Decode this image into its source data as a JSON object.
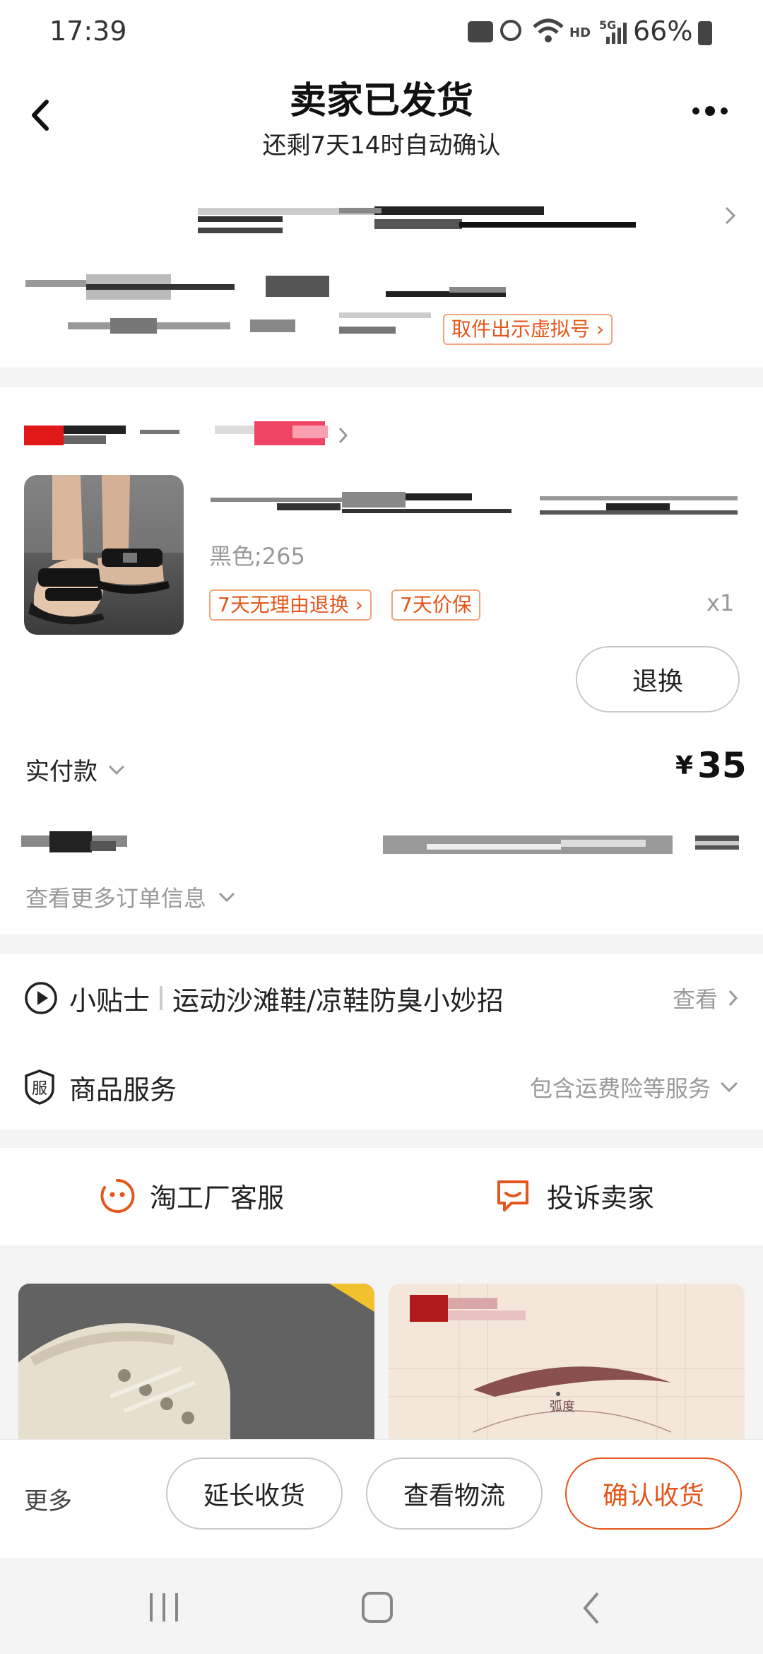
{
  "status_bar": {
    "time": "17:39",
    "hd": "HD",
    "network": "5G",
    "battery": "66%"
  },
  "header": {
    "title": "卖家已发货",
    "subtitle": "还剩7天14时自动确认",
    "back_icon": "back-arrow-icon",
    "more_icon": "more-dots-icon"
  },
  "delivery": {
    "virtual_number_button": "取件出示虚拟号"
  },
  "order": {
    "product_variant": "黑色;265",
    "badges": [
      "7天无理由退换",
      "7天价保"
    ],
    "quantity": "x1",
    "exchange_button": "退换",
    "paid_label": "实付款",
    "currency": "¥",
    "paid_amount": "35",
    "more_info": "查看更多订单信息"
  },
  "tips": {
    "label": "小贴士",
    "text": "运动沙滩鞋/凉鞋防臭小妙招",
    "action": "查看"
  },
  "service": {
    "label": "商品服务",
    "detail": "包含运费险等服务",
    "badge_char": "服"
  },
  "support": {
    "customer_service": "淘工厂客服",
    "complain": "投诉卖家"
  },
  "recommendations": {
    "brow_caption": "弧度"
  },
  "bottom_bar": {
    "more": "更多",
    "extend": "延长收货",
    "logistics": "查看物流",
    "confirm": "确认收货"
  },
  "colors": {
    "accent": "#e4561a",
    "page_bg": "#f4f4f5"
  }
}
